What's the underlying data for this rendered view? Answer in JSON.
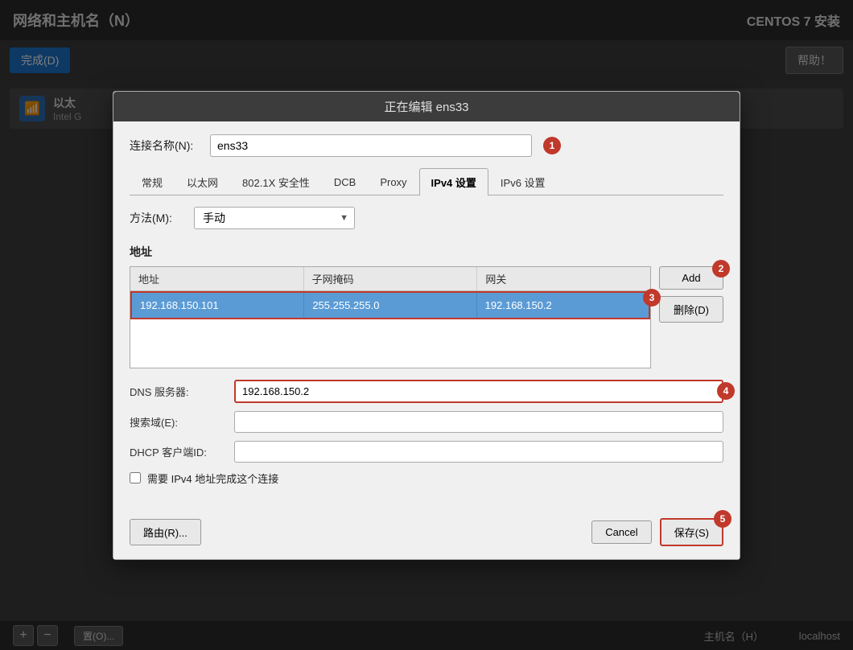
{
  "app": {
    "title": "网络和主机名（N）",
    "centos_label": "CENTOS 7 安装",
    "help_label": "帮助！",
    "done_label": "完成(D)"
  },
  "network_device": {
    "label": "以太",
    "sublabel": "Intel G"
  },
  "modal": {
    "title": "正在编辑 ens33",
    "connection_name_label": "连接名称(N):",
    "connection_name_value": "ens33"
  },
  "tabs": [
    {
      "id": "general",
      "label": "常规",
      "active": false
    },
    {
      "id": "ethernet",
      "label": "以太网",
      "active": false
    },
    {
      "id": "security",
      "label": "802.1X 安全性",
      "active": false
    },
    {
      "id": "dcb",
      "label": "DCB",
      "active": false
    },
    {
      "id": "proxy",
      "label": "Proxy",
      "active": false
    },
    {
      "id": "ipv4",
      "label": "IPv4 设置",
      "active": true
    },
    {
      "id": "ipv6",
      "label": "IPv6 设置",
      "active": false
    }
  ],
  "ipv4": {
    "method_label": "方法(M):",
    "method_value": "手动",
    "address_section_title": "地址",
    "table_headers": [
      "地址",
      "子网掩码",
      "网关"
    ],
    "table_rows": [
      {
        "address": "192.168.150.101",
        "subnet": "255.255.255.0",
        "gateway": "192.168.150.2"
      }
    ],
    "add_button": "Add",
    "delete_button": "删除(D)",
    "dns_label": "DNS 服务器:",
    "dns_value": "192.168.150.2",
    "search_label": "搜索域(E):",
    "search_value": "",
    "dhcp_label": "DHCP 客户端ID:",
    "dhcp_value": "",
    "checkbox_label": "需要 IPv4 地址完成这个连接",
    "route_button": "路由(R)...",
    "cancel_button": "Cancel",
    "save_button": "保存(S)"
  },
  "badges": {
    "b1": "1",
    "b2": "2",
    "b3": "3",
    "b4": "4",
    "b5": "5"
  },
  "bottom_bar": {
    "hostname_label": "主机名（H）",
    "hostname_value": "localhost",
    "settings_label": "置(O)..."
  }
}
